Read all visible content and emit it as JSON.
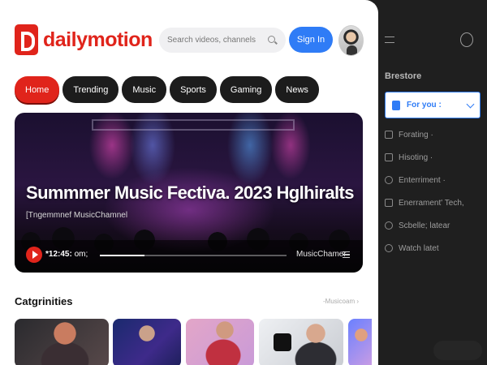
{
  "header": {
    "logo_text": "dailymotion",
    "search_placeholder": "Search videos, channels",
    "signin_label": "Sign In"
  },
  "tabs": [
    "Home",
    "Trending",
    "Music",
    "Sports",
    "Gaming",
    "News"
  ],
  "hero": {
    "title": "Summmer Music Fectiva. 2023 Hglhiralts",
    "channel": "[Tngemmnef MusicChamnel",
    "time": "*12:45:",
    "time_suffix": "om;",
    "player_channel": "MusicChamer",
    "progress": 0.24
  },
  "categories": {
    "title": "Catgrinities",
    "link": "-Musicoam ›"
  },
  "sidebar": {
    "heading": "Brestore",
    "selected": "For you :",
    "items": [
      {
        "label": "Forating ·",
        "icon": "trending-icon"
      },
      {
        "label": "Hisoting ·",
        "icon": "history-icon"
      },
      {
        "label": "Enterriment ·",
        "icon": "entertainment-icon"
      },
      {
        "label": "Enerrament' Tech,",
        "icon": "tech-icon"
      },
      {
        "label": "Scbelle; latear",
        "icon": "schedule-icon"
      },
      {
        "label": "Watch latet",
        "icon": "watch-later-icon"
      }
    ]
  },
  "colors": {
    "brand_red": "#e0241b",
    "accent_blue": "#2f7cf6",
    "sidebar_bg": "#1f1f1f"
  }
}
